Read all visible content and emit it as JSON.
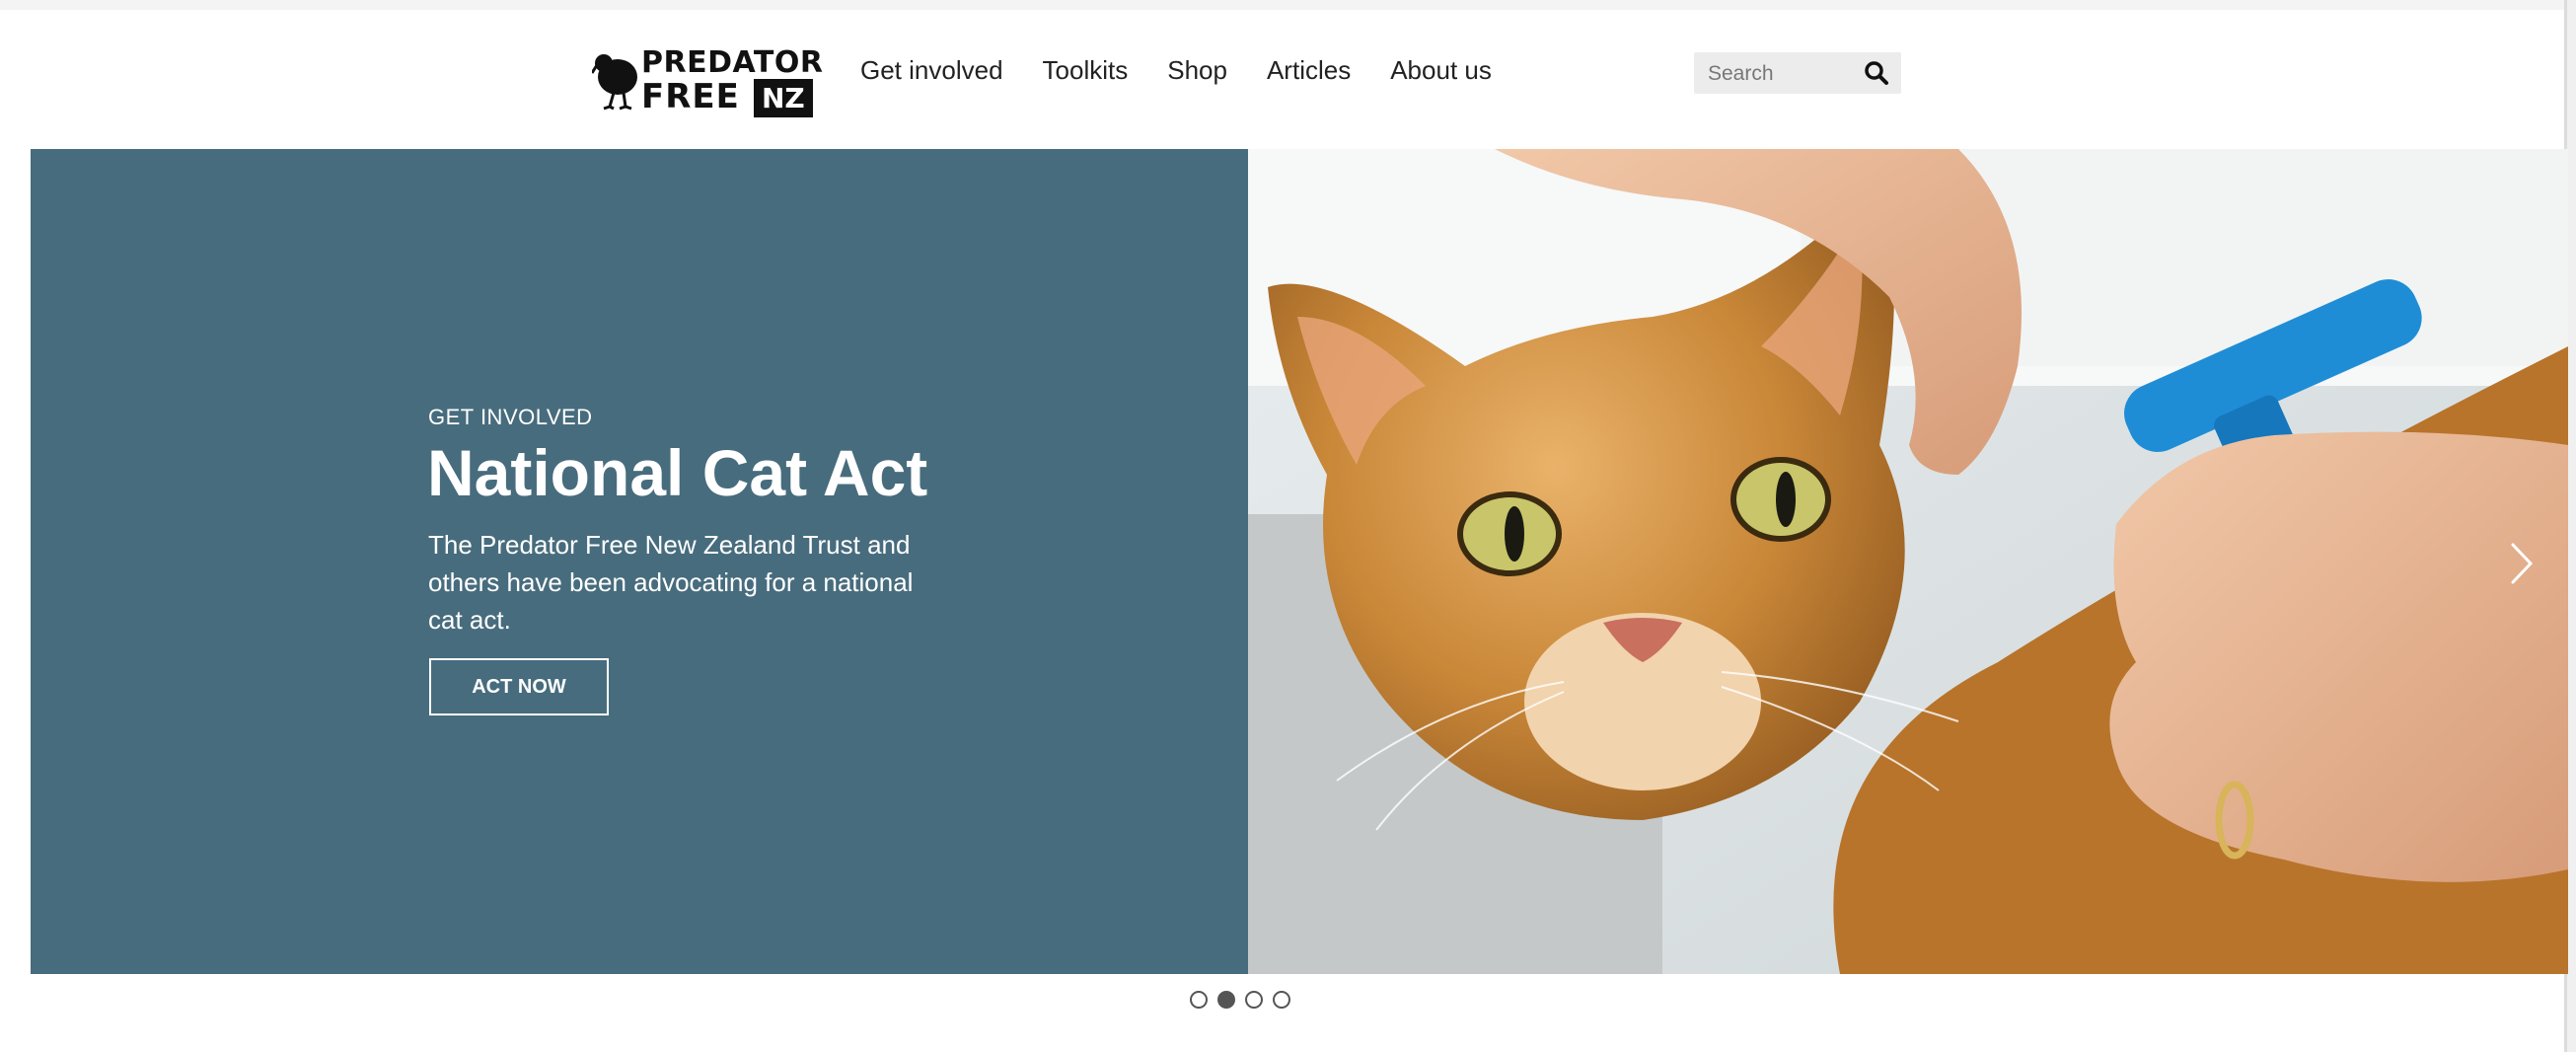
{
  "header": {
    "logo": {
      "line1": "PREDATOR",
      "line2": "FREE",
      "badge": "NZ"
    },
    "nav": [
      {
        "label": "Get involved"
      },
      {
        "label": "Toolkits"
      },
      {
        "label": "Shop"
      },
      {
        "label": "Articles"
      },
      {
        "label": "About us"
      }
    ],
    "search": {
      "placeholder": "Search",
      "value": ""
    }
  },
  "hero": {
    "eyebrow": "GET INVOLVED",
    "title": "National Cat Act",
    "description": "The Predator Free New Zealand Trust and others have been advocating for a national cat act.",
    "cta_label": "ACT NOW",
    "panel_color": "#476c7d",
    "image_icon": "cat-microchip-photo",
    "next_icon": "chevron-right-icon"
  },
  "carousel": {
    "slide_count": 4,
    "active_slide": 2
  }
}
